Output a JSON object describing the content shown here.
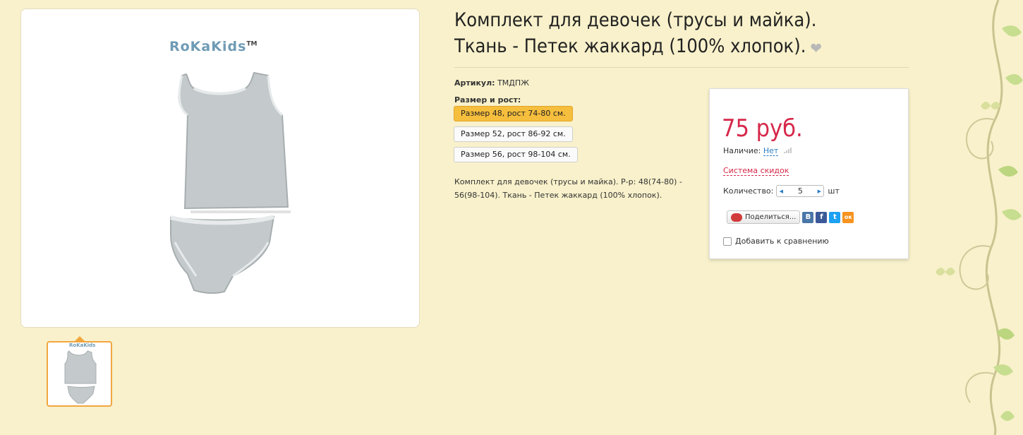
{
  "product": {
    "title_line1": "Комплект для девочек (трусы и майка).",
    "title_line2": "Ткань - Петек жаккард (100% хлопок).",
    "favorite_icon": "heart-icon",
    "brand": "RoKaKids",
    "brand_tm": "TM",
    "sku_label": "Артикул:",
    "sku_value": "ТМДПЖ",
    "size_label": "Размер и рост:",
    "sizes": [
      {
        "label": "Размер 48, рост 74-80 см.",
        "selected": true
      },
      {
        "label": "Размер 52, рост 86-92 см.",
        "selected": false
      },
      {
        "label": "Размер 56, рост 98-104 см.",
        "selected": false
      }
    ],
    "description_line1": "Комплект для девочек (трусы и майка). Р-р: 48(74-80) -",
    "description_line2": "56(98-104). Ткань - Петек жаккард (100% хлопок)."
  },
  "buybox": {
    "price": "75 руб.",
    "availability_label": "Наличие:",
    "availability_value": "Нет",
    "discount_link": "Система скидок",
    "quantity_label": "Количество:",
    "quantity_value": "5",
    "quantity_unit": "шт",
    "share_label": "Поделиться...",
    "socials": [
      {
        "name": "vk",
        "glyph": "В",
        "color": "#4a76a8"
      },
      {
        "name": "facebook",
        "glyph": "f",
        "color": "#3b5998"
      },
      {
        "name": "twitter",
        "glyph": "t",
        "color": "#1da1f2"
      },
      {
        "name": "odnoklassniki",
        "glyph": "ок",
        "color": "#f7931e"
      }
    ],
    "compare_label": "Добавить к сравнению"
  },
  "colors": {
    "background": "#f8f1cb",
    "accent_price": "#d6284a",
    "selected_size": "#f6be3d",
    "link_blue": "#2a7fc7",
    "thumb_border": "#f2a640"
  }
}
